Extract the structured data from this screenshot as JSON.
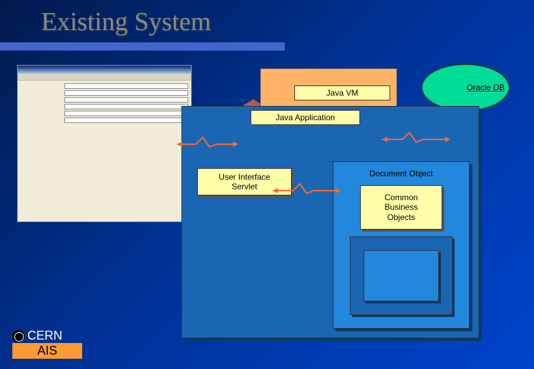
{
  "title": "Existing System",
  "boxes": {
    "jvm": "Java VM",
    "app": "Java Application",
    "servlet": "User Interface\nServlet",
    "docobj": "Document Object",
    "cbo": "Common\nBusiness\nObjects",
    "oracle": "Oracle DB"
  },
  "footer": {
    "org": "CERN",
    "dept": "AIS"
  }
}
